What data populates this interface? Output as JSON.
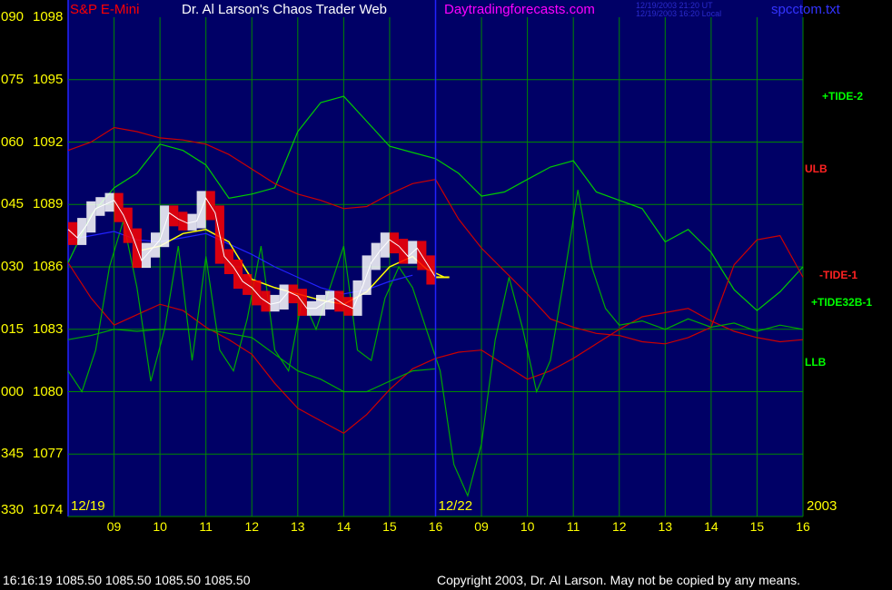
{
  "header": {
    "instrument": "S&P E-Mini",
    "title": "Dr. Al Larson's Chaos Trader Web",
    "site": "Daytradingforecasts.com",
    "stamp_ut": "12/19/2003 21:20 UT",
    "stamp_local": "12/19/2003 16:20 Local",
    "file": "spcctom.txt"
  },
  "footer": {
    "quote": "16:16:19  1085.50 1085.50 1085.50 1085.50",
    "copyright": "Copyright 2003, Dr. Al Larson. May not be copied by any means."
  },
  "colors": {
    "background": "#000000",
    "plot_background": "#000066",
    "grid": "#008800",
    "price": "#ffffff",
    "price_down": "#ff0000",
    "average": "#ffff00",
    "tide_2": "#00cc00",
    "ulb": "#cc0000",
    "tide_1": "#cc0000",
    "tide32b_1": "#00aa00",
    "llb": "#00aa00",
    "blue_line": "#2222ff",
    "instrument_label": "#ff0000",
    "site_label": "#ff00ff",
    "file_label": "#3333ff",
    "axis_labels": "#ffff00"
  },
  "chart_data": {
    "type": "line",
    "title": "S&P E-Mini",
    "y_axis": {
      "range": [
        1074,
        1098
      ],
      "ticks": [
        {
          "angle": "090",
          "price": "1098"
        },
        {
          "angle": "075",
          "price": "1095"
        },
        {
          "angle": "060",
          "price": "1092"
        },
        {
          "angle": "045",
          "price": "1089"
        },
        {
          "angle": "030",
          "price": "1086"
        },
        {
          "angle": "015",
          "price": "1083"
        },
        {
          "angle": "000",
          "price": "1080"
        },
        {
          "angle": "345",
          "price": "1077"
        },
        {
          "angle": "330",
          "price": "1074"
        }
      ]
    },
    "x_axis": {
      "range": [
        0,
        16
      ],
      "session_dates": [
        {
          "label": "12/19",
          "x": 0
        },
        {
          "label": "12/22",
          "x": 8
        },
        {
          "label": "2003",
          "x": 16
        }
      ],
      "ticks": [
        {
          "label": "09",
          "x": 1
        },
        {
          "label": "10",
          "x": 2
        },
        {
          "label": "11",
          "x": 3
        },
        {
          "label": "12",
          "x": 4
        },
        {
          "label": "13",
          "x": 5
        },
        {
          "label": "14",
          "x": 6
        },
        {
          "label": "15",
          "x": 7
        },
        {
          "label": "16",
          "x": 8
        },
        {
          "label": "09",
          "x": 9
        },
        {
          "label": "10",
          "x": 10
        },
        {
          "label": "11",
          "x": 11
        },
        {
          "label": "12",
          "x": 12
        },
        {
          "label": "13",
          "x": 13
        },
        {
          "label": "14",
          "x": 14
        },
        {
          "label": "15",
          "x": 15
        },
        {
          "label": "16",
          "x": 16
        }
      ]
    },
    "last_price": 1085.5,
    "series": [
      {
        "name": "+TIDE-2",
        "color": "#00cc00",
        "x": [
          0,
          0.5,
          1.0,
          1.5,
          2.0,
          2.5,
          3.0,
          3.5,
          4.0,
          4.5,
          5.0,
          5.5,
          6.0,
          6.5,
          7.0,
          7.5,
          8.0,
          8.5,
          9.0,
          9.5,
          10.0,
          10.5,
          11.0,
          11.5,
          12.0,
          12.5,
          13.0,
          13.5,
          14.0,
          14.5,
          15.0,
          15.5,
          16.0
        ],
        "values": [
          1086.2,
          1088.5,
          1089.8,
          1090.5,
          1091.9,
          1091.6,
          1090.9,
          1089.3,
          1089.5,
          1089.8,
          1092.5,
          1093.9,
          1094.2,
          1093.0,
          1091.8,
          1091.5,
          1091.2,
          1090.5,
          1089.4,
          1089.6,
          1090.2,
          1090.8,
          1091.1,
          1089.6,
          1089.2,
          1088.8,
          1087.2,
          1087.8,
          1086.7,
          1084.9,
          1083.9,
          1084.8,
          1086.0
        ]
      },
      {
        "name": "ULB",
        "color": "#cc0000",
        "x": [
          0,
          0.5,
          1.0,
          1.5,
          2.0,
          2.5,
          3.0,
          3.5,
          4.0,
          4.5,
          5.0,
          5.5,
          6.0,
          6.5,
          7.0,
          7.5,
          8.0,
          8.5,
          9.0,
          9.5,
          10.0,
          10.5,
          11.0,
          11.5,
          12.0,
          12.5,
          13.0,
          13.5,
          14.0,
          14.5,
          15.0,
          15.5,
          16.0
        ],
        "values": [
          1091.6,
          1092.0,
          1092.7,
          1092.5,
          1092.2,
          1092.1,
          1091.9,
          1091.4,
          1090.7,
          1090.0,
          1089.5,
          1089.2,
          1088.8,
          1088.9,
          1089.5,
          1090.0,
          1090.2,
          1088.3,
          1086.9,
          1085.8,
          1084.7,
          1083.5,
          1083.1,
          1082.8,
          1082.7,
          1082.4,
          1082.3,
          1082.6,
          1083.1,
          1086.1,
          1087.3,
          1087.5,
          1085.5
        ]
      },
      {
        "name": "-TIDE-1",
        "color": "#cc0000",
        "x": [
          0,
          0.5,
          1.0,
          1.5,
          2.0,
          2.5,
          3.0,
          3.5,
          4.0,
          4.5,
          5.0,
          5.5,
          6.0,
          6.5,
          7.0,
          7.5,
          8.0,
          8.5,
          9.0,
          9.5,
          10.0,
          10.5,
          11.0,
          11.5,
          12.0,
          12.5,
          13.0,
          13.5,
          14.0,
          14.5,
          15.0,
          15.5,
          16.0
        ],
        "values": [
          1086.2,
          1084.5,
          1083.2,
          1083.7,
          1084.2,
          1083.9,
          1083.1,
          1082.5,
          1081.8,
          1080.4,
          1079.2,
          1078.6,
          1078.0,
          1078.9,
          1080.1,
          1081.1,
          1081.6,
          1081.9,
          1082.0,
          1081.3,
          1080.6,
          1081.0,
          1081.6,
          1082.3,
          1083.0,
          1083.6,
          1083.8,
          1084.0,
          1083.4,
          1082.9,
          1082.6,
          1082.4,
          1082.5
        ]
      },
      {
        "name": "+TIDE32B-1",
        "color": "#00aa00",
        "x": [
          0,
          0.3,
          0.6,
          0.9,
          1.2,
          1.5,
          1.8,
          2.1,
          2.4,
          2.7,
          3.0,
          3.3,
          3.6,
          3.9,
          4.2,
          4.5,
          4.8,
          5.1,
          5.4,
          5.7,
          6.0,
          6.3,
          6.6,
          6.9,
          7.2,
          7.5,
          7.8,
          8.1,
          8.4,
          8.7,
          9.0,
          9.3,
          9.6,
          9.9,
          10.2,
          10.5,
          10.8,
          11.1,
          11.4,
          11.7,
          12.0,
          12.5,
          13.0,
          13.5,
          14.0,
          14.5,
          15.0,
          15.5,
          16.0
        ],
        "values": [
          1081.0,
          1080.0,
          1082.0,
          1086.0,
          1088.2,
          1085.0,
          1080.5,
          1083.0,
          1087.0,
          1081.5,
          1086.5,
          1082.0,
          1081.0,
          1083.5,
          1087.0,
          1082.0,
          1081.0,
          1084.5,
          1083.0,
          1085.0,
          1087.0,
          1082.0,
          1081.5,
          1084.5,
          1086.0,
          1085.0,
          1083.0,
          1081.0,
          1076.5,
          1075.0,
          1077.5,
          1082.5,
          1085.5,
          1083.0,
          1080.0,
          1081.5,
          1085.5,
          1089.7,
          1086.0,
          1084.0,
          1083.2,
          1083.4,
          1083.0,
          1083.5,
          1083.1,
          1083.3,
          1082.9,
          1083.2,
          1083.0
        ]
      },
      {
        "name": "LLB",
        "color": "#00aa00",
        "x": [
          0,
          0.5,
          1.0,
          1.5,
          2.0,
          2.5,
          3.0,
          3.5,
          4.0,
          4.5,
          5.0,
          5.5,
          6.0,
          6.5,
          7.0,
          7.5,
          8.0
        ],
        "values": [
          1082.5,
          1082.7,
          1083.0,
          1082.9,
          1083.0,
          1083.0,
          1083.0,
          1082.8,
          1082.6,
          1081.8,
          1081.0,
          1080.6,
          1080.0,
          1080.0,
          1080.5,
          1081.0,
          1081.1
        ]
      },
      {
        "name": "Blue",
        "color": "#2222ff",
        "x": [
          0,
          0.5,
          1.0,
          1.5,
          2.0,
          2.5,
          3.0,
          3.5,
          4.0,
          4.5,
          5.0,
          5.5,
          6.0,
          6.5,
          7.0,
          7.5
        ],
        "values": [
          1087.3,
          1087.5,
          1087.7,
          1087.3,
          1087.2,
          1087.4,
          1087.6,
          1087.1,
          1086.6,
          1086.0,
          1085.5,
          1085.0,
          1084.7,
          1084.9,
          1085.3,
          1085.6
        ]
      },
      {
        "name": "Price",
        "color": "#ffffff",
        "x": [
          0,
          0.2,
          0.4,
          0.6,
          0.8,
          1.0,
          1.2,
          1.4,
          1.6,
          1.8,
          2.0,
          2.2,
          2.4,
          2.6,
          2.8,
          3.0,
          3.2,
          3.4,
          3.6,
          3.8,
          4.0,
          4.2,
          4.4,
          4.6,
          4.8,
          5.0,
          5.2,
          5.4,
          5.6,
          5.8,
          6.0,
          6.2,
          6.4,
          6.6,
          6.8,
          7.0,
          7.2,
          7.4,
          7.6,
          7.8,
          8.0
        ],
        "values": [
          1087.8,
          1087.4,
          1088.0,
          1088.8,
          1089.0,
          1089.2,
          1088.5,
          1087.5,
          1086.3,
          1086.8,
          1087.3,
          1088.6,
          1088.3,
          1088.1,
          1088.2,
          1089.3,
          1088.6,
          1086.5,
          1086.0,
          1085.3,
          1085.0,
          1084.5,
          1084.2,
          1084.3,
          1084.8,
          1084.6,
          1084.0,
          1084.0,
          1084.3,
          1084.5,
          1084.2,
          1084.0,
          1085.0,
          1086.2,
          1086.8,
          1087.3,
          1087.0,
          1086.5,
          1086.9,
          1086.2,
          1085.5
        ]
      },
      {
        "name": "Average",
        "color": "#ffff00",
        "x": [
          1.6,
          2.0,
          2.5,
          3.0,
          3.5,
          4.0,
          4.5,
          5.0,
          5.5,
          6.0,
          6.5,
          7.0,
          7.5,
          7.8,
          8.2
        ],
        "values": [
          1086.8,
          1087.0,
          1087.6,
          1087.8,
          1087.2,
          1085.4,
          1085.0,
          1084.7,
          1084.4,
          1084.2,
          1084.8,
          1086.0,
          1086.5,
          1085.9,
          1085.5
        ]
      }
    ],
    "right_labels": [
      "+TIDE-2",
      "ULB",
      "-TIDE-1",
      "+TIDE32B-1",
      "LLB"
    ]
  }
}
